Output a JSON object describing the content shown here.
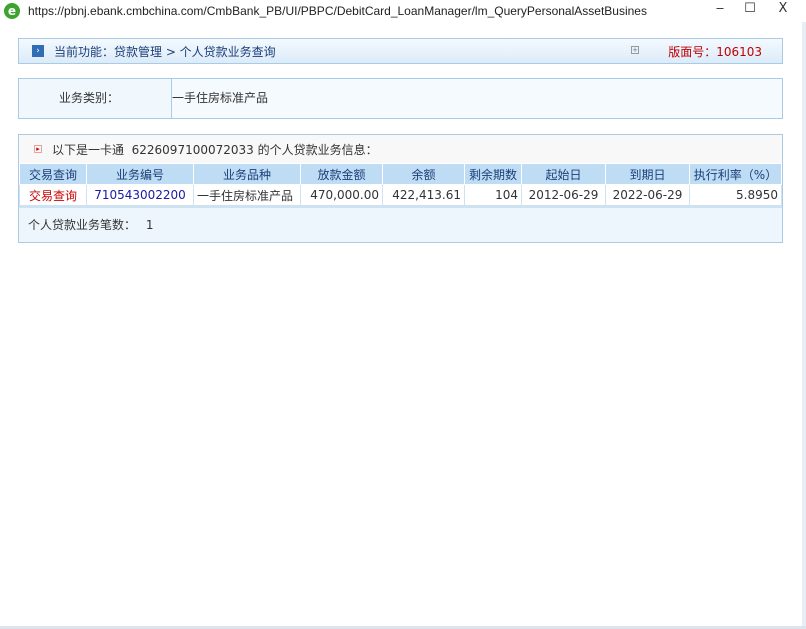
{
  "window": {
    "url": "https://pbnj.ebank.cmbchina.com/CmbBank_PB/UI/PBPC/DebitCard_LoanManager/lm_QueryPersonalAssetBusines",
    "min": "‒",
    "max": "☐",
    "close": "X"
  },
  "header": {
    "crumb": "当前功能：贷款管理 > 个人贷款业务查询",
    "version": "版面号：106103"
  },
  "category": {
    "label": "业务类别：",
    "value": "一手住房标准产品"
  },
  "info": {
    "caption": "以下是一卡通  6226097100072033 的个人贷款业务信息：",
    "columns": [
      "交易查询",
      "业务编号",
      "业务品种",
      "放款金额",
      "余额",
      "剩余期数",
      "起始日",
      "到期日",
      "执行利率（%）"
    ],
    "rows": [
      [
        "交易查询",
        "710543002200",
        "一手住房标准产品",
        "470,000.00",
        "422,413.61",
        "104",
        "2012-06-29",
        "2022-06-29",
        "5.8950"
      ]
    ],
    "count_label": "个人贷款业务笔数：",
    "count": "1"
  }
}
